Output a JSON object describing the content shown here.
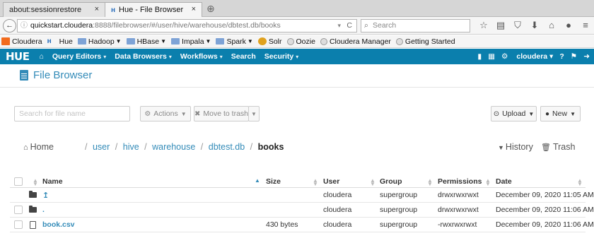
{
  "browser": {
    "tabs": [
      {
        "label": "about:sessionrestore",
        "close": "×"
      },
      {
        "label": "Hue - File Browser",
        "close": "×",
        "favicon": "hue-icon"
      }
    ],
    "new_tab": "⊕",
    "back": "←",
    "url_host": "quickstart.cloudera",
    "url_path": ":8888/filebrowser/#/user/hive/warehouse/dbtest.db/books",
    "reload": "C",
    "search_placeholder": "Search",
    "nav_icons": [
      "star-icon",
      "reading-list-icon",
      "pocket-icon",
      "download-icon",
      "home-icon",
      "chat-icon",
      "menu-icon"
    ]
  },
  "bookmarks": [
    {
      "label": "Cloudera",
      "icon": "cloudera-icon"
    },
    {
      "label": "Hue",
      "icon": "hue-icon"
    },
    {
      "label": "Hadoop",
      "icon": "folder-icon",
      "dropdown": true
    },
    {
      "label": "HBase",
      "icon": "folder-icon",
      "dropdown": true
    },
    {
      "label": "Impala",
      "icon": "folder-icon",
      "dropdown": true
    },
    {
      "label": "Spark",
      "icon": "folder-icon",
      "dropdown": true
    },
    {
      "label": "Solr",
      "icon": "solr-icon"
    },
    {
      "label": "Oozie",
      "icon": "globe-icon"
    },
    {
      "label": "Cloudera Manager",
      "icon": "globe-icon"
    },
    {
      "label": "Getting Started",
      "icon": "globe-icon"
    }
  ],
  "hue_nav": {
    "logo": "HUE",
    "items": [
      {
        "label": "Query Editors",
        "dropdown": true
      },
      {
        "label": "Data Browsers",
        "dropdown": true
      },
      {
        "label": "Workflows",
        "dropdown": true
      },
      {
        "label": "Search",
        "dropdown": false
      },
      {
        "label": "Security",
        "dropdown": true
      }
    ],
    "user": "cloudera",
    "brand_color": "#0b7fad"
  },
  "page": {
    "title": "File Browser",
    "accent_color": "#338bb8"
  },
  "toolbar": {
    "search_placeholder": "Search for file name",
    "actions_label": "Actions",
    "move_to_trash_label": "Move to trash",
    "upload_label": "Upload",
    "new_label": "New"
  },
  "breadcrumb": {
    "home_label": "Home",
    "segments": [
      "user",
      "hive",
      "warehouse",
      "dbtest.db"
    ],
    "current": "books",
    "separator": "/",
    "history_label": "History",
    "trash_label": "Trash"
  },
  "table": {
    "headers": {
      "name": "Name",
      "size": "Size",
      "user": "User",
      "group": "Group",
      "permissions": "Permissions",
      "date": "Date"
    },
    "rows": [
      {
        "type": "folder",
        "name": "↥",
        "size": "",
        "user": "cloudera",
        "group": "supergroup",
        "permissions": "drwxrwxrwxt",
        "date": "December 09, 2020 11:05 AM",
        "checkbox": false
      },
      {
        "type": "folder",
        "name": ".",
        "size": "",
        "user": "cloudera",
        "group": "supergroup",
        "permissions": "drwxrwxrwxt",
        "date": "December 09, 2020 11:06 AM",
        "checkbox": true
      },
      {
        "type": "file",
        "name": "book.csv",
        "size": "430 bytes",
        "user": "cloudera",
        "group": "supergroup",
        "permissions": "-rwxrwxrwxt",
        "date": "December 09, 2020 11:06 AM",
        "checkbox": true
      }
    ]
  }
}
